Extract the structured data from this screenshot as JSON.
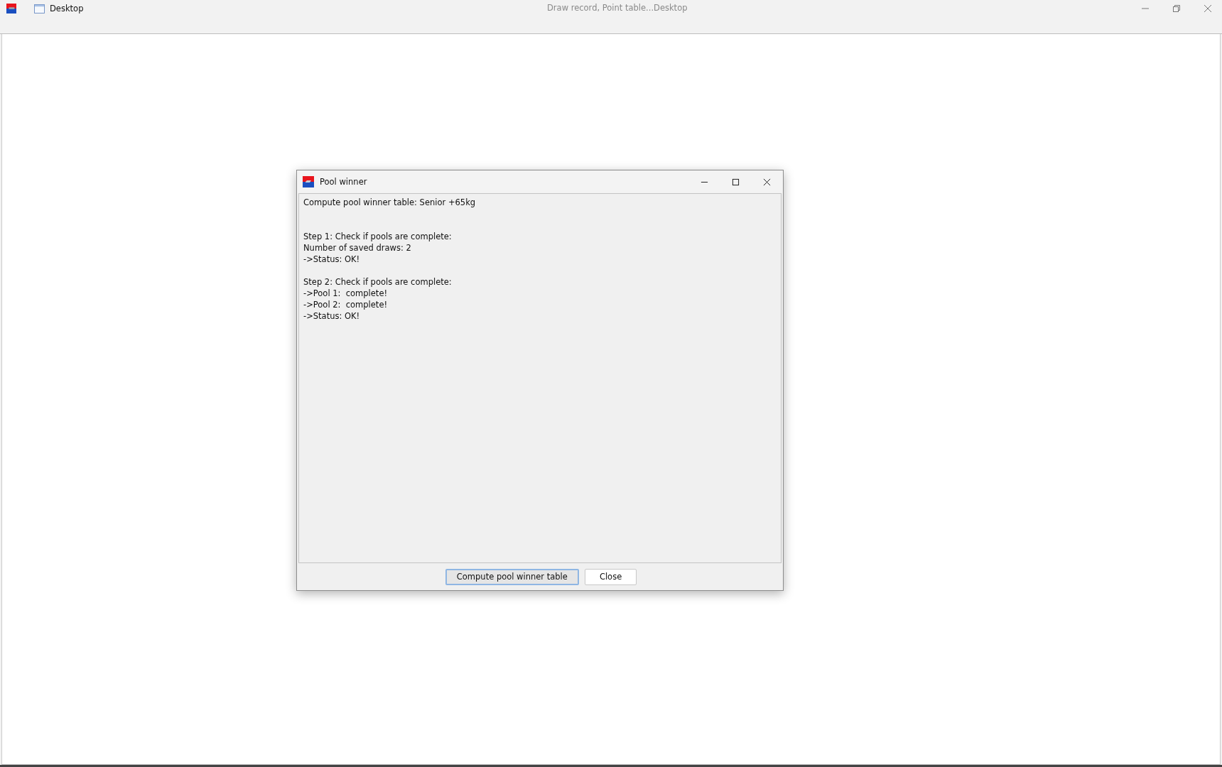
{
  "window": {
    "title": "Desktop",
    "subtitle": "Draw record, Point table...Desktop"
  },
  "dialog": {
    "title": "Pool winner",
    "heading": "Compute pool winner table: Senior +65kg",
    "steps": [
      [
        "Step 1: Check if pools are complete:",
        "Number of saved draws: 2",
        "->Status: OK!"
      ],
      [
        "Step 2: Check if pools are complete:",
        "->Pool 1:  complete!",
        "->Pool 2:  complete!",
        "->Status: OK!"
      ]
    ],
    "buttons": [
      {
        "label": "Compute pool winner table",
        "default": true
      },
      {
        "label": "Close",
        "default": false
      }
    ]
  }
}
